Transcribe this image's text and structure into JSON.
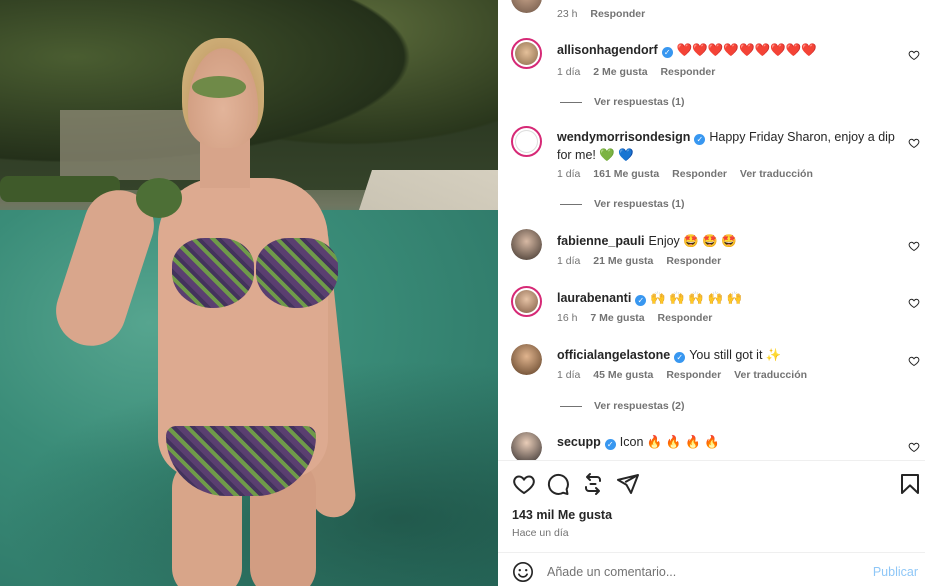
{
  "comments": [
    {
      "meta": {
        "time": "23 h",
        "reply": "Responder"
      }
    },
    {
      "user": "allisonhagendorf",
      "verified": true,
      "text": "❤️❤️❤️❤️❤️❤️❤️❤️❤️",
      "meta": {
        "time": "1 día",
        "likes": "2 Me gusta",
        "reply": "Responder"
      },
      "replies": "Ver respuestas (1)"
    },
    {
      "user": "wendymorrisondesign",
      "verified": true,
      "text": "Happy Friday Sharon, enjoy a dip for me! 💚 💙",
      "meta": {
        "time": "1 día",
        "likes": "161 Me gusta",
        "reply": "Responder",
        "translate": "Ver traducción"
      },
      "replies": "Ver respuestas (1)"
    },
    {
      "user": "fabienne_pauli",
      "verified": false,
      "text": "Enjoy 🤩 🤩 🤩",
      "meta": {
        "time": "1 día",
        "likes": "21 Me gusta",
        "reply": "Responder"
      }
    },
    {
      "user": "laurabenanti",
      "verified": true,
      "text": "🙌 🙌 🙌 🙌 🙌",
      "meta": {
        "time": "16 h",
        "likes": "7 Me gusta",
        "reply": "Responder"
      }
    },
    {
      "user": "officialangelastone",
      "verified": true,
      "text": "You still got it ✨",
      "meta": {
        "time": "1 día",
        "likes": "45 Me gusta",
        "reply": "Responder",
        "translate": "Ver traducción"
      },
      "replies": "Ver respuestas (2)"
    },
    {
      "user": "secupp",
      "verified": true,
      "text": "Icon 🔥 🔥 🔥 🔥"
    }
  ],
  "verified_glyph": "✓",
  "post": {
    "likes": "143 mil Me gusta",
    "time": "Hace un día"
  },
  "add_comment": {
    "placeholder": "Añade un comentario...",
    "post_label": "Publicar"
  },
  "icons": {
    "like": "heart-icon",
    "comment": "comment-icon",
    "share": "repost-icon",
    "send": "send-icon",
    "save": "bookmark-icon",
    "emoji": "emoji-icon"
  },
  "colors": {
    "text": "#262626",
    "muted": "#737373",
    "verified": "#3897f0",
    "post_button": "#8fc7f7",
    "story_ring": "#d62976"
  }
}
